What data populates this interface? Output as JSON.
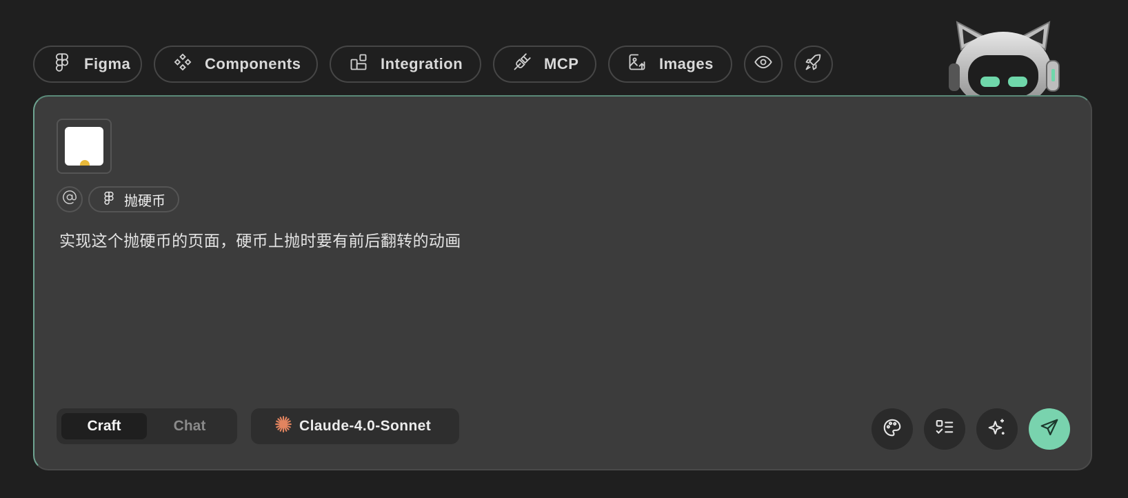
{
  "toolbar": {
    "figma_label": "Figma",
    "components_label": "Components",
    "integration_label": "Integration",
    "mcp_label": "MCP",
    "images_label": "Images"
  },
  "input": {
    "mention_tag": "抛硬币",
    "prompt_text": "实现这个抛硬币的页面，硬币上抛时要有前后翻转的动画"
  },
  "modes": {
    "craft_label": "Craft",
    "chat_label": "Chat",
    "active": "Craft"
  },
  "model": {
    "name": "Claude-4.0-Sonnet"
  },
  "icons": {
    "toolbar": [
      "figma-icon",
      "components-icon",
      "integration-icon",
      "plug-icon",
      "image-upload-icon",
      "eye-icon",
      "rocket-icon"
    ],
    "actions": [
      "palette-icon",
      "checklist-icon",
      "sparkle-icon",
      "send-icon"
    ],
    "model": "claude-starburst-icon",
    "mention": "at-icon"
  },
  "colors": {
    "background": "#1f1f1f",
    "panel": "#3c3c3c",
    "accent": "#79d3ae",
    "claude": "#e2845f"
  }
}
